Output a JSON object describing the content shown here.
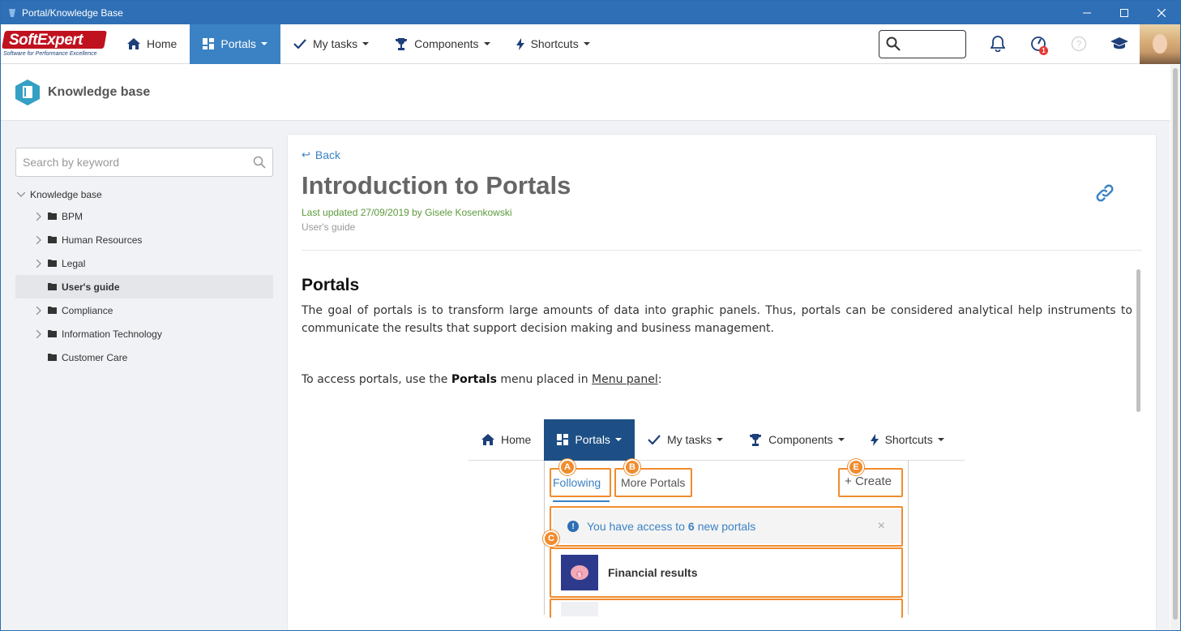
{
  "window": {
    "title": "Portal/Knowledge Base"
  },
  "brand": {
    "name": "SoftExpert",
    "tagline": "Software for Performance Excellence"
  },
  "topnav": {
    "items": [
      {
        "label": "Home",
        "icon": "home-icon",
        "active": false,
        "dropdown": false
      },
      {
        "label": "Portals",
        "icon": "portals-icon",
        "active": true,
        "dropdown": true
      },
      {
        "label": "My tasks",
        "icon": "check-icon",
        "active": false,
        "dropdown": true
      },
      {
        "label": "Components",
        "icon": "trophy-icon",
        "active": false,
        "dropdown": true
      },
      {
        "label": "Shortcuts",
        "icon": "bolt-icon",
        "active": false,
        "dropdown": true
      }
    ],
    "search_placeholder": "",
    "badge_count": "1"
  },
  "page": {
    "title": "Knowledge base"
  },
  "sidebar": {
    "search_placeholder": "Search by keyword",
    "root": "Knowledge base",
    "items": [
      {
        "label": "BPM",
        "expandable": true,
        "selected": false
      },
      {
        "label": "Human Resources",
        "expandable": true,
        "selected": false
      },
      {
        "label": "Legal",
        "expandable": true,
        "selected": false
      },
      {
        "label": "User's guide",
        "expandable": false,
        "selected": true
      },
      {
        "label": "Compliance",
        "expandable": true,
        "selected": false
      },
      {
        "label": "Information Technology",
        "expandable": true,
        "selected": false
      },
      {
        "label": "Customer Care",
        "expandable": false,
        "selected": false
      }
    ]
  },
  "article": {
    "back_label": "Back",
    "title": "Introduction to Portals",
    "meta": "Last updated 27/09/2019 by Gisele Kosenkowski",
    "category": "User's guide",
    "section_title": "Portals",
    "paragraph1": "The goal of portals is to transform large amounts of data into graphic panels. Thus, portals can be considered analytical help instruments to communicate the results that support decision making and business management.",
    "paragraph2_prefix": "To access portals, use the ",
    "paragraph2_bold": "Portals",
    "paragraph2_mid": " menu placed in ",
    "paragraph2_link": "Menu panel",
    "paragraph2_suffix": ":"
  },
  "illustration": {
    "nav": [
      "Home",
      "Portals",
      "My tasks",
      "Components",
      "Shortcuts"
    ],
    "tab_following": "Following",
    "tab_more": "More Portals",
    "create": "Create",
    "notice_prefix": "You have access to ",
    "notice_count": "6",
    "notice_suffix": " new portals",
    "notice_close": "×",
    "portal_name": "Financial results",
    "markers": {
      "a": "A",
      "b": "B",
      "c": "C",
      "e": "E"
    }
  },
  "colors": {
    "accent": "#3b82c4",
    "titlebar": "#2f6fb5",
    "highlight": "#f08c2e",
    "meta": "#5b9a3a"
  }
}
